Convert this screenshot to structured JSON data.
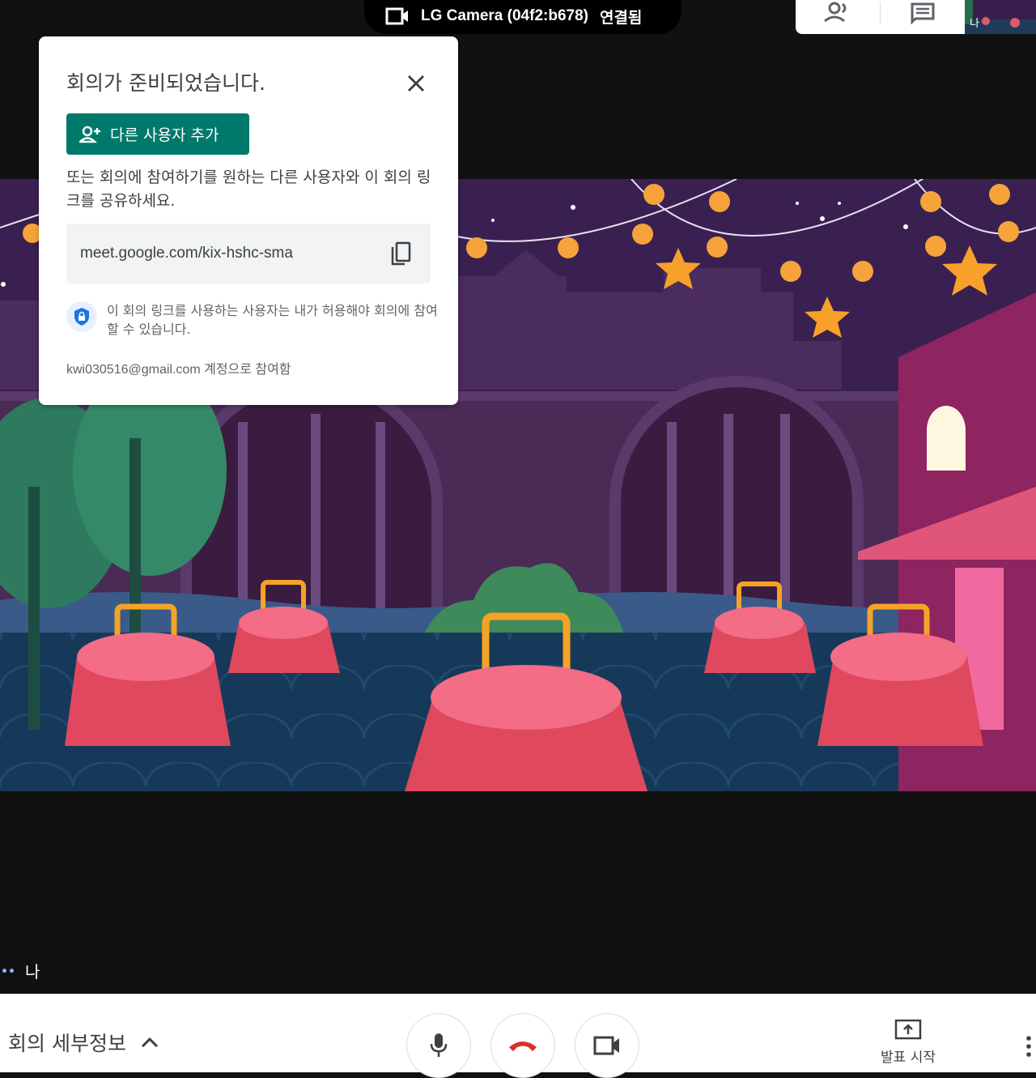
{
  "camera_status": {
    "device": "LG Camera (04f2:b678)",
    "state": "연결됨"
  },
  "self_thumbnail_label": "나",
  "dialog": {
    "title": "회의가 준비되었습니다.",
    "add_button": "다른 사용자 추가",
    "description": "또는 회의에 참여하기를 원하는 다른 사용자와 이 회의 링크를 공유하세요.",
    "meeting_link": "meet.google.com/kix-hshc-sma",
    "notice": "이 회의 링크를 사용하는 사용자는 내가 허용해야 회의에 참여할 수 있습니다.",
    "joined_as": "kwi030516@gmail.com 계정으로 참여함"
  },
  "self_name": "나",
  "bottom_bar": {
    "details": "회의 세부정보",
    "present": "발표 시작"
  },
  "colors": {
    "accent": "#00796b",
    "hangup": "#d93025",
    "scene_sky": "#3a2051"
  }
}
